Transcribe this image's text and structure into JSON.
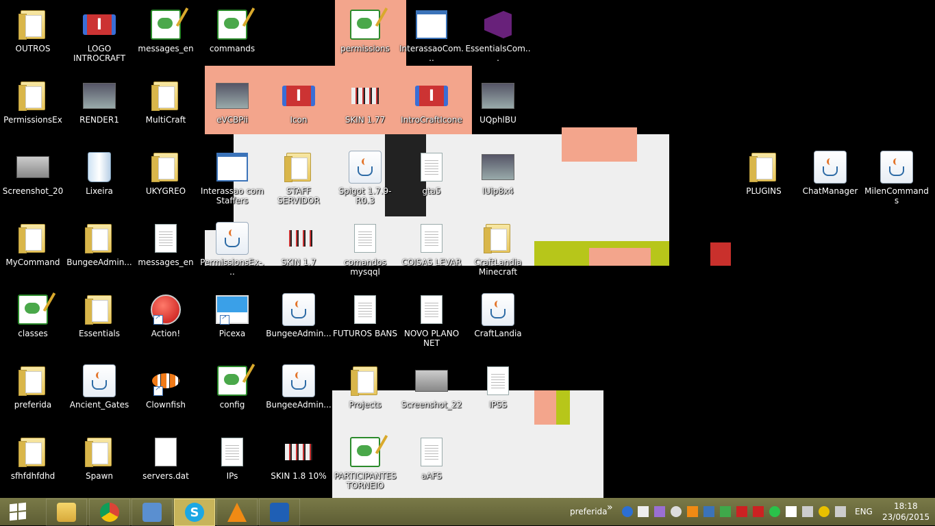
{
  "desktop": {
    "icons": [
      {
        "label": "OUTROS",
        "kind": "folder"
      },
      {
        "label": "LOGO INTROCRAFT",
        "kind": "logo"
      },
      {
        "label": "messages_en",
        "kind": "notepad"
      },
      {
        "label": "commands",
        "kind": "notepad"
      },
      {
        "label": "permissions",
        "kind": "notepad"
      },
      {
        "label": "InterassaoCom...",
        "kind": "window"
      },
      {
        "label": "EssentialsCom...",
        "kind": "vs"
      },
      {
        "label": "PermissionsEx",
        "kind": "folder"
      },
      {
        "label": "RENDER1",
        "kind": "photo"
      },
      {
        "label": "MultiCraft",
        "kind": "folder"
      },
      {
        "label": "eVCBPii",
        "kind": "photo"
      },
      {
        "label": "Icon",
        "kind": "logo"
      },
      {
        "label": "SKIN 1.77",
        "kind": "skin"
      },
      {
        "label": "IntroCraftIcone",
        "kind": "logo"
      },
      {
        "label": "UQphlBU",
        "kind": "photo"
      },
      {
        "label": "Screenshot_20",
        "kind": "screenshot"
      },
      {
        "label": "Lixeira",
        "kind": "recycle"
      },
      {
        "label": "UKYGREO",
        "kind": "folder"
      },
      {
        "label": "Interassao com Staffers",
        "kind": "window"
      },
      {
        "label": "STAFF SERVIDOR",
        "kind": "folder"
      },
      {
        "label": "Spigot 1.7.9-R0.3",
        "kind": "java"
      },
      {
        "label": "gta5",
        "kind": "doc"
      },
      {
        "label": "IUip8x4",
        "kind": "photo"
      },
      {
        "label": "PLUGINS",
        "kind": "folder"
      },
      {
        "label": "ChatManager",
        "kind": "java"
      },
      {
        "label": "MilenCommands",
        "kind": "java"
      },
      {
        "label": "MyCommand",
        "kind": "folder"
      },
      {
        "label": "BungeeAdmin...",
        "kind": "folder"
      },
      {
        "label": "messages_en",
        "kind": "doc"
      },
      {
        "label": "PermissionsEx-...",
        "kind": "java"
      },
      {
        "label": "SKIN 1.7",
        "kind": "skin"
      },
      {
        "label": "comandos mysqql",
        "kind": "doc"
      },
      {
        "label": "COISAS LEVAR",
        "kind": "doc"
      },
      {
        "label": "CraftLandia Minecraft",
        "kind": "folder"
      },
      {
        "label": "classes",
        "kind": "notepad"
      },
      {
        "label": "Essentials",
        "kind": "folder"
      },
      {
        "label": "Action!",
        "kind": "action"
      },
      {
        "label": "Picexa",
        "kind": "picexa"
      },
      {
        "label": "BungeeAdmin...",
        "kind": "java"
      },
      {
        "label": "FUTUROS BANS",
        "kind": "doc"
      },
      {
        "label": "NOVO PLANO NET",
        "kind": "doc"
      },
      {
        "label": "CraftLandia",
        "kind": "java"
      },
      {
        "label": "preferida",
        "kind": "folder"
      },
      {
        "label": "Ancient_Gates",
        "kind": "java"
      },
      {
        "label": "Clownfish",
        "kind": "fish"
      },
      {
        "label": "config",
        "kind": "notepad"
      },
      {
        "label": "BungeeAdmin...",
        "kind": "java"
      },
      {
        "label": "Projects",
        "kind": "folder"
      },
      {
        "label": "Screenshot_22",
        "kind": "screenshot"
      },
      {
        "label": "IPSS",
        "kind": "doc"
      },
      {
        "label": "sfhfdhfdhd",
        "kind": "folder"
      },
      {
        "label": "Spawn",
        "kind": "folder"
      },
      {
        "label": "servers.dat",
        "kind": "dat"
      },
      {
        "label": "IPs",
        "kind": "doc"
      },
      {
        "label": "SKIN 1.8 10%",
        "kind": "skin"
      },
      {
        "label": "PARTICIPANTES TORNEIO",
        "kind": "notepad"
      },
      {
        "label": "aAFS",
        "kind": "doc"
      }
    ]
  },
  "taskbar": {
    "pinned": [
      "file-explorer",
      "chrome",
      "control-panel",
      "skype",
      "vlc",
      "mail"
    ],
    "active_app": "skype",
    "toolbar_label": "preferida",
    "language": "ENG",
    "time": "18:18",
    "date": "23/06/2015",
    "colors": {
      "taskbar": "#6a6a3c",
      "active": "#c7b45a"
    }
  }
}
